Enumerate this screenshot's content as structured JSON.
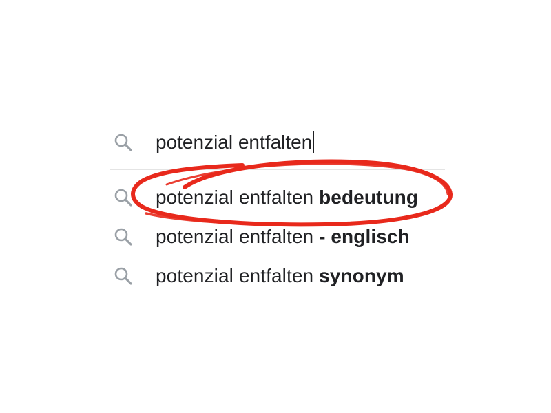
{
  "search": {
    "query": "potenzial entfalten",
    "icon": "search-icon"
  },
  "suggestions": [
    {
      "prefix": "potenzial entfalten ",
      "completion": "bedeutung",
      "highlighted": true
    },
    {
      "prefix": "potenzial entfalten ",
      "completion": "- englisch",
      "highlighted": false
    },
    {
      "prefix": "potenzial entfalten ",
      "completion": "synonym",
      "highlighted": false
    }
  ],
  "colors": {
    "text": "#202124",
    "icon": "#9aa0a6",
    "divider": "#e4e4e4",
    "annotation": "#e8291c"
  }
}
